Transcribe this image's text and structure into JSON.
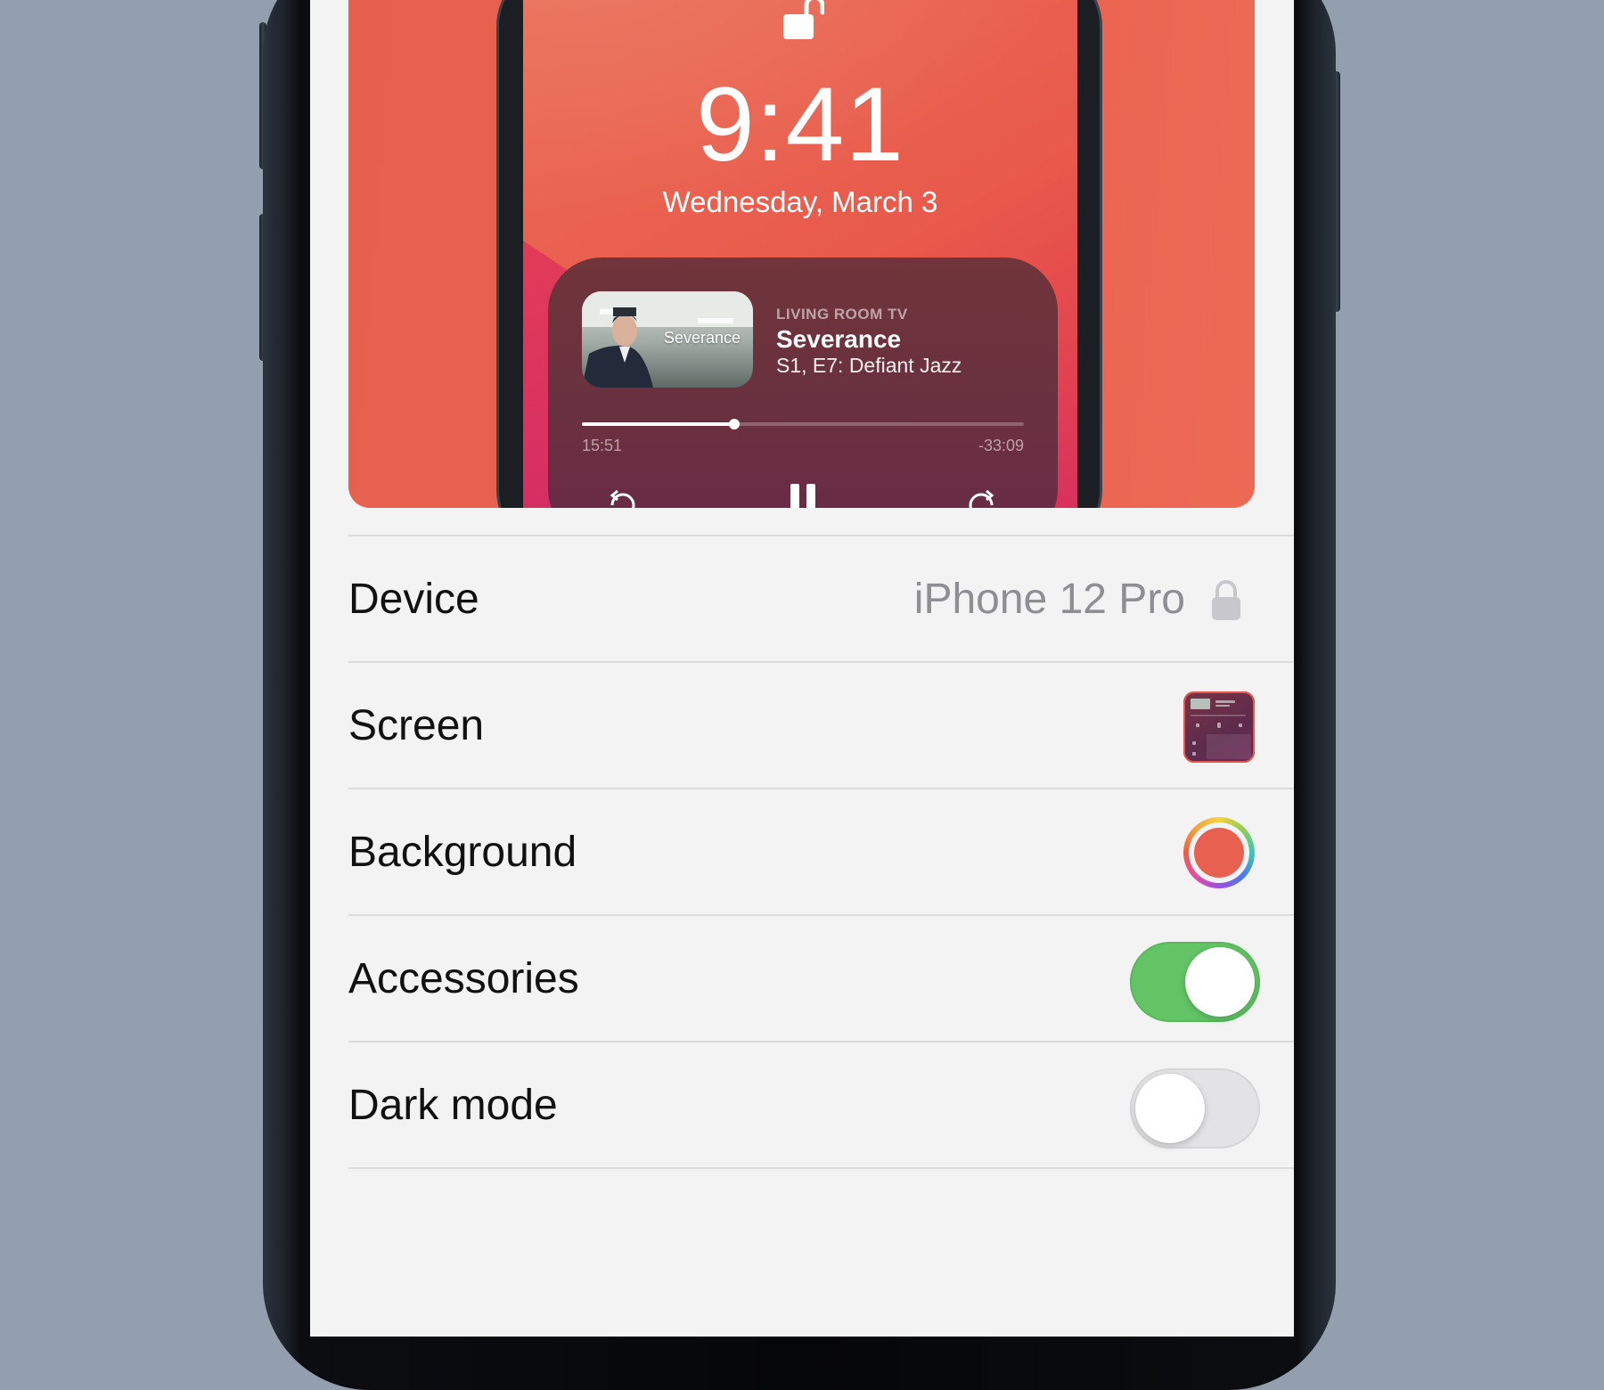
{
  "preview": {
    "lock_screen": {
      "time": "9:41",
      "date": "Wednesday, March 3"
    },
    "now_playing": {
      "source": "LIVING ROOM TV",
      "title": "Severance",
      "subtitle": "S1, E7: Defiant Jazz",
      "artwork_text": "Severance",
      "elapsed": "15:51",
      "remaining": "-33:09",
      "progress_fraction": 0.345
    }
  },
  "settings": {
    "rows": [
      {
        "label": "Device",
        "value": "iPhone 12 Pro",
        "control": "locked-value"
      },
      {
        "label": "Screen",
        "control": "screen-thumbnail"
      },
      {
        "label": "Background",
        "control": "color-picker",
        "color": "#e8604f"
      },
      {
        "label": "Accessories",
        "control": "toggle",
        "on": true
      },
      {
        "label": "Dark mode",
        "control": "toggle",
        "on": false
      }
    ]
  },
  "colors": {
    "page_background": "#939eae",
    "screen_background": "#f3f3f3",
    "toggle_on": "#62c465",
    "toggle_off": "#e3e3e5",
    "secondary_text": "#8e8e93",
    "wallpaper_accent": "#e8604f"
  }
}
